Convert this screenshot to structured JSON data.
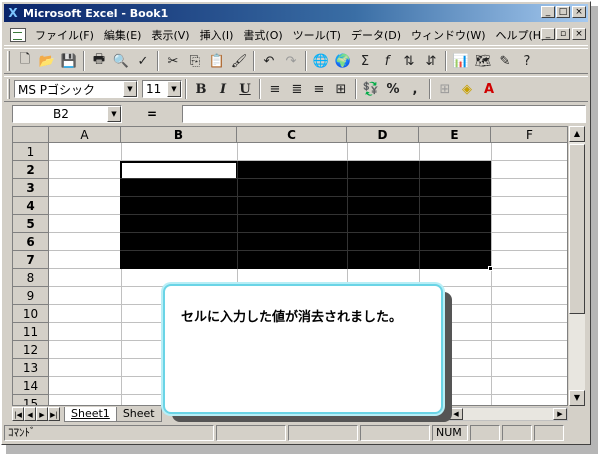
{
  "window": {
    "title": "Microsoft Excel - Book1",
    "app_icon": "X"
  },
  "menu": {
    "items": [
      "ファイル(F)",
      "編集(E)",
      "表示(V)",
      "挿入(I)",
      "書式(O)",
      "ツール(T)",
      "データ(D)",
      "ウィンドウ(W)",
      "ヘルプ(H)"
    ]
  },
  "toolbar2": {
    "font_name": "MS Pゴシック",
    "font_size": "11",
    "bold_label": "B",
    "italic_label": "I",
    "underline_label": "U",
    "percent_label": "%",
    "comma_label": ","
  },
  "formula_bar": {
    "name_box": "B2",
    "equals": "=",
    "value": ""
  },
  "grid": {
    "columns": [
      "A",
      "B",
      "C",
      "D",
      "E",
      "F"
    ],
    "rows": [
      "1",
      "2",
      "3",
      "4",
      "5",
      "6",
      "7",
      "8",
      "9",
      "10",
      "11",
      "12",
      "13",
      "14",
      "15"
    ],
    "selection": "B2:E7",
    "active_cell": "B2"
  },
  "sheets": {
    "tabs": [
      "Sheet1",
      "Sheet"
    ],
    "active": "Sheet1"
  },
  "status": {
    "mode": "ｺﾏﾝﾄﾞ",
    "num": "NUM"
  },
  "callout": {
    "text": "セルに入力した値が消去されました。"
  },
  "colors": {
    "selection": "#000000",
    "callout_border": "#6ad4e6",
    "title_bar": "#0a246a"
  }
}
